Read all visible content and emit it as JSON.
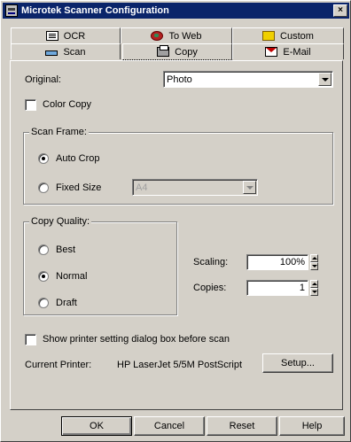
{
  "window": {
    "title": "Microtek Scanner Configuration",
    "close_label": "×"
  },
  "tabs": {
    "back_row": [
      {
        "label": "OCR",
        "icon": "ocr-icon"
      },
      {
        "label": "To Web",
        "icon": "globe-icon"
      },
      {
        "label": "Custom",
        "icon": "folder-icon"
      }
    ],
    "front_row": [
      {
        "label": "Scan",
        "icon": "scanner-icon"
      },
      {
        "label": "Copy",
        "icon": "copier-icon",
        "selected": true
      },
      {
        "label": "E-Mail",
        "icon": "mail-icon"
      }
    ]
  },
  "copy": {
    "original_label": "Original:",
    "original_value": "Photo",
    "color_copy_label": "Color Copy",
    "color_copy_checked": false,
    "scan_frame": {
      "title": "Scan Frame:",
      "auto_crop_label": "Auto Crop",
      "fixed_size_label": "Fixed Size",
      "selected": "Auto Crop",
      "fixed_size_value": "A4"
    },
    "copy_quality": {
      "title": "Copy Quality:",
      "options": [
        "Best",
        "Normal",
        "Draft"
      ],
      "selected": "Normal"
    },
    "scaling_label": "Scaling:",
    "scaling_value": "100%",
    "copies_label": "Copies:",
    "copies_value": "1",
    "show_printer_label": "Show printer setting dialog box before scan",
    "show_printer_checked": false,
    "current_printer_label": "Current Printer:",
    "current_printer_value": "HP LaserJet 5/5M PostScript",
    "setup_label": "Setup..."
  },
  "footer": {
    "ok": "OK",
    "cancel": "Cancel",
    "reset": "Reset",
    "help": "Help"
  }
}
